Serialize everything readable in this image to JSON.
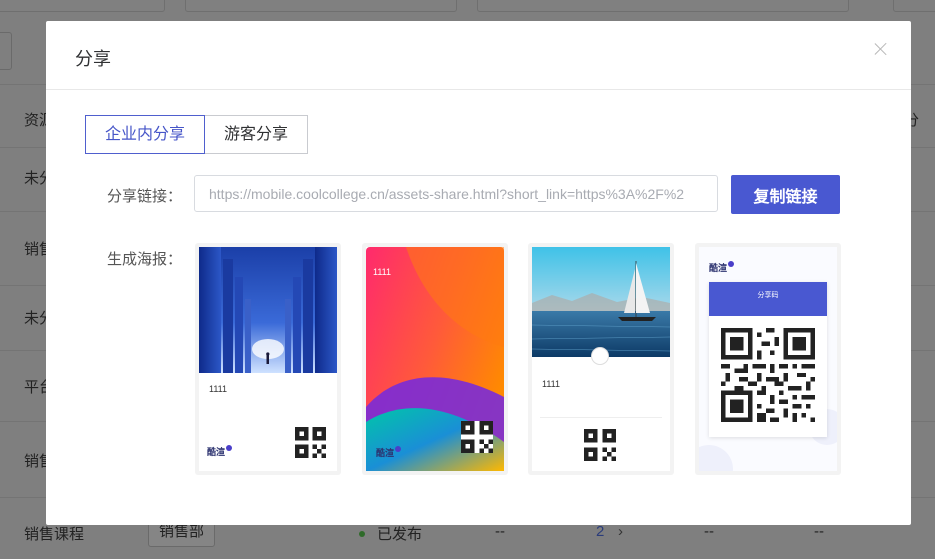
{
  "background": {
    "rows": [
      {
        "label": "资源"
      },
      {
        "label": "未分"
      },
      {
        "label": "销售"
      },
      {
        "label": "未分"
      },
      {
        "label": "平台"
      },
      {
        "label": "销售"
      }
    ],
    "right_header_fragment": "分",
    "bottom_row": {
      "name": "销售课程",
      "department": "销售部",
      "status": "已发布",
      "col_a": "--",
      "count": "2",
      "col_b": "--",
      "col_c": "--"
    }
  },
  "modal": {
    "title": "分享",
    "tabs": [
      {
        "label": "企业内分享",
        "active": true
      },
      {
        "label": "游客分享",
        "active": false
      }
    ],
    "share_link_label": "分享链接：",
    "share_link_value": "https://mobile.coolcollege.cn/assets-share.html?short_link=https%3A%2F%2",
    "copy_button_label": "复制链接",
    "poster_label": "生成海报：",
    "posters": [
      {
        "style": "buildings",
        "title": "1111",
        "logo": "酷渲"
      },
      {
        "style": "gradient",
        "title": "1111",
        "logo": "酷渲"
      },
      {
        "style": "sailboat",
        "title": "1111"
      },
      {
        "style": "qr-card",
        "logo": "酷渲",
        "banner": "分享码"
      }
    ]
  },
  "colors": {
    "accent": "#4958d1",
    "overlay": "#7f7f7f"
  }
}
